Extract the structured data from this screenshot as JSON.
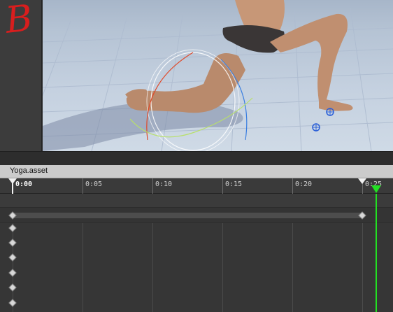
{
  "panel": {
    "letter": "B"
  },
  "timeline": {
    "asset_name": "Yoga.asset",
    "time_labels": [
      "0:00",
      "0:05",
      "0:10",
      "0:15",
      "0:20",
      "0:25"
    ],
    "playhead_label": "0:25"
  },
  "colors": {
    "playhead": "#22e022",
    "panel_letter": "#d81e1e"
  },
  "icons": [
    "start-marker-icon",
    "end-marker-icon",
    "playhead-marker-icon",
    "keyframe-icon",
    "ik-target-icon"
  ]
}
